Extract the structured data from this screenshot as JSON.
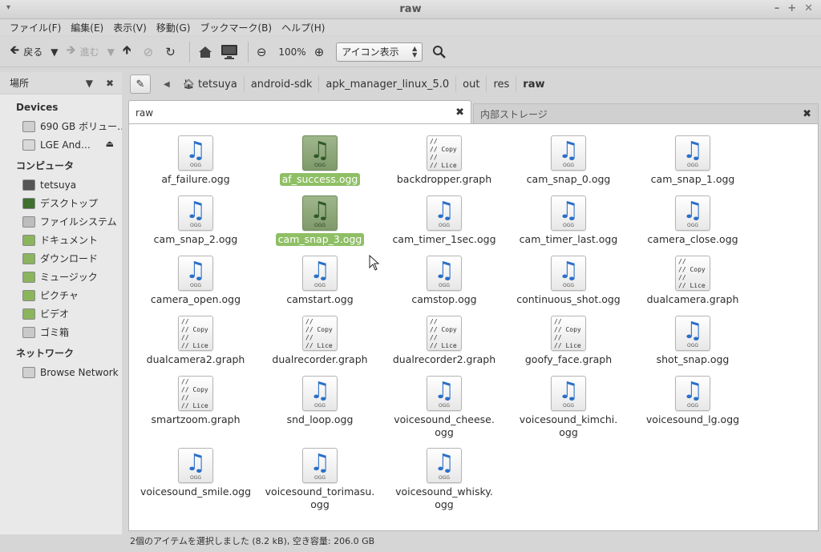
{
  "window": {
    "title": "raw",
    "menu_arrow": "▾",
    "minimize": "–",
    "maximize": "+",
    "close": "✕"
  },
  "menubar": [
    "ファイル(F)",
    "編集(E)",
    "表示(V)",
    "移動(G)",
    "ブックマーク(B)",
    "ヘルプ(H)"
  ],
  "toolbar": {
    "back_label": "戻る",
    "forward_label": "進む",
    "zoom_value": "100%",
    "view_mode": "アイコン表示"
  },
  "sidebar": {
    "title": "場所",
    "sections": [
      {
        "title": "Devices",
        "items": [
          {
            "label": "690 GB ボリュー…",
            "icon": "hdd",
            "color": "#cfcfcf"
          },
          {
            "label": "LGE And…",
            "icon": "device",
            "color": "#d8d8d8",
            "eject": "⏏"
          }
        ]
      },
      {
        "title": "コンピュータ",
        "items": [
          {
            "label": "tetsuya",
            "icon": "home",
            "color": "#555555"
          },
          {
            "label": "デスクトップ",
            "icon": "desktop",
            "color": "#3d6f2f"
          },
          {
            "label": "ファイルシステム",
            "icon": "filesystem",
            "color": "#bdbdbd"
          },
          {
            "label": "ドキュメント",
            "icon": "folder-documents",
            "color": "#8bb55c"
          },
          {
            "label": "ダウンロード",
            "icon": "folder-download",
            "color": "#8bb55c"
          },
          {
            "label": "ミュージック",
            "icon": "folder-music",
            "color": "#8bb55c"
          },
          {
            "label": "ピクチャ",
            "icon": "folder-pictures",
            "color": "#8bb55c"
          },
          {
            "label": "ビデオ",
            "icon": "folder-videos",
            "color": "#8bb55c"
          },
          {
            "label": "ゴミ箱",
            "icon": "trash",
            "color": "#c9c9c9"
          }
        ]
      },
      {
        "title": "ネットワーク",
        "items": [
          {
            "label": "Browse Network",
            "icon": "network",
            "color": "#d0d0d0"
          }
        ]
      }
    ]
  },
  "breadcrumb": [
    "tetsuya",
    "android-sdk",
    "apk_manager_linux_5.0",
    "out",
    "res",
    "raw"
  ],
  "tabs": [
    {
      "label": "raw",
      "active": true
    },
    {
      "label": "内部ストレージ",
      "active": false
    }
  ],
  "icon_texts": {
    "audio_tag": "OGG",
    "graph_code": "//\n// Copy\n//\n// Lice"
  },
  "files": [
    {
      "name": "af_failure.ogg",
      "type": "audio",
      "selected": false
    },
    {
      "name": "af_success.ogg",
      "type": "audio",
      "selected": true
    },
    {
      "name": "backdropper.graph",
      "type": "graph",
      "selected": false
    },
    {
      "name": "cam_snap_0.ogg",
      "type": "audio",
      "selected": false
    },
    {
      "name": "cam_snap_1.ogg",
      "type": "audio",
      "selected": false
    },
    {
      "name": "cam_snap_2.ogg",
      "type": "audio",
      "selected": false
    },
    {
      "name": "cam_snap_3.ogg",
      "type": "audio",
      "selected": true
    },
    {
      "name": "cam_timer_1sec.ogg",
      "type": "audio",
      "selected": false
    },
    {
      "name": "cam_timer_last.ogg",
      "type": "audio",
      "selected": false
    },
    {
      "name": "camera_close.ogg",
      "type": "audio",
      "selected": false
    },
    {
      "name": "camera_open.ogg",
      "type": "audio",
      "selected": false
    },
    {
      "name": "camstart.ogg",
      "type": "audio",
      "selected": false
    },
    {
      "name": "camstop.ogg",
      "type": "audio",
      "selected": false
    },
    {
      "name": "continuous_shot.ogg",
      "type": "audio",
      "selected": false
    },
    {
      "name": "dualcamera.graph",
      "type": "graph",
      "selected": false
    },
    {
      "name": "dualcamera2.graph",
      "type": "graph",
      "selected": false
    },
    {
      "name": "dualrecorder.graph",
      "type": "graph",
      "selected": false
    },
    {
      "name": "dualrecorder2.graph",
      "type": "graph",
      "selected": false
    },
    {
      "name": "goofy_face.graph",
      "type": "graph",
      "selected": false
    },
    {
      "name": "shot_snap.ogg",
      "type": "audio",
      "selected": false
    },
    {
      "name": "smartzoom.graph",
      "type": "graph",
      "selected": false
    },
    {
      "name": "snd_loop.ogg",
      "type": "audio",
      "selected": false
    },
    {
      "name": "voicesound_cheese.\nogg",
      "type": "audio",
      "selected": false
    },
    {
      "name": "voicesound_kimchi.\nogg",
      "type": "audio",
      "selected": false
    },
    {
      "name": "voicesound_lg.ogg",
      "type": "audio",
      "selected": false
    },
    {
      "name": "voicesound_smile.ogg",
      "type": "audio",
      "selected": false
    },
    {
      "name": "voicesound_torimasu.\nogg",
      "type": "audio",
      "selected": false
    },
    {
      "name": "voicesound_whisky.\nogg",
      "type": "audio",
      "selected": false
    }
  ],
  "status": "2個のアイテムを選択しました (8.2 kB), 空き容量: 206.0 GB"
}
